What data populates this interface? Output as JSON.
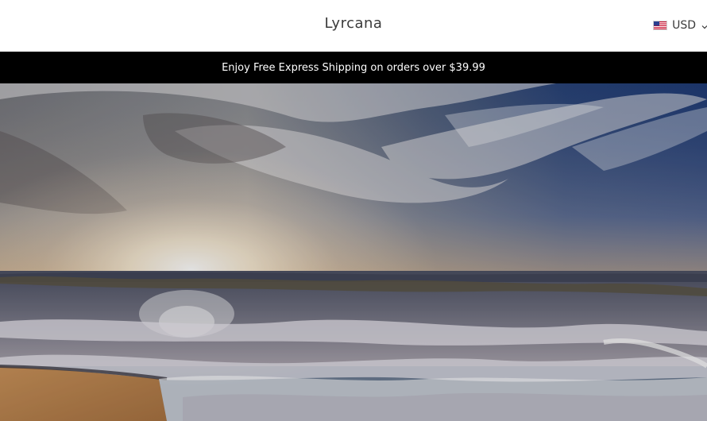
{
  "header": {
    "logo_text": "Lyrcana",
    "currency": {
      "code": "USD",
      "flag_icon": "us-flag-icon",
      "dropdown_icon": "chevron-down-icon"
    }
  },
  "announcement": {
    "text": "Enjoy Free Express Shipping on orders over $39.99"
  },
  "hero": {
    "image_icon": "hero-image"
  }
}
